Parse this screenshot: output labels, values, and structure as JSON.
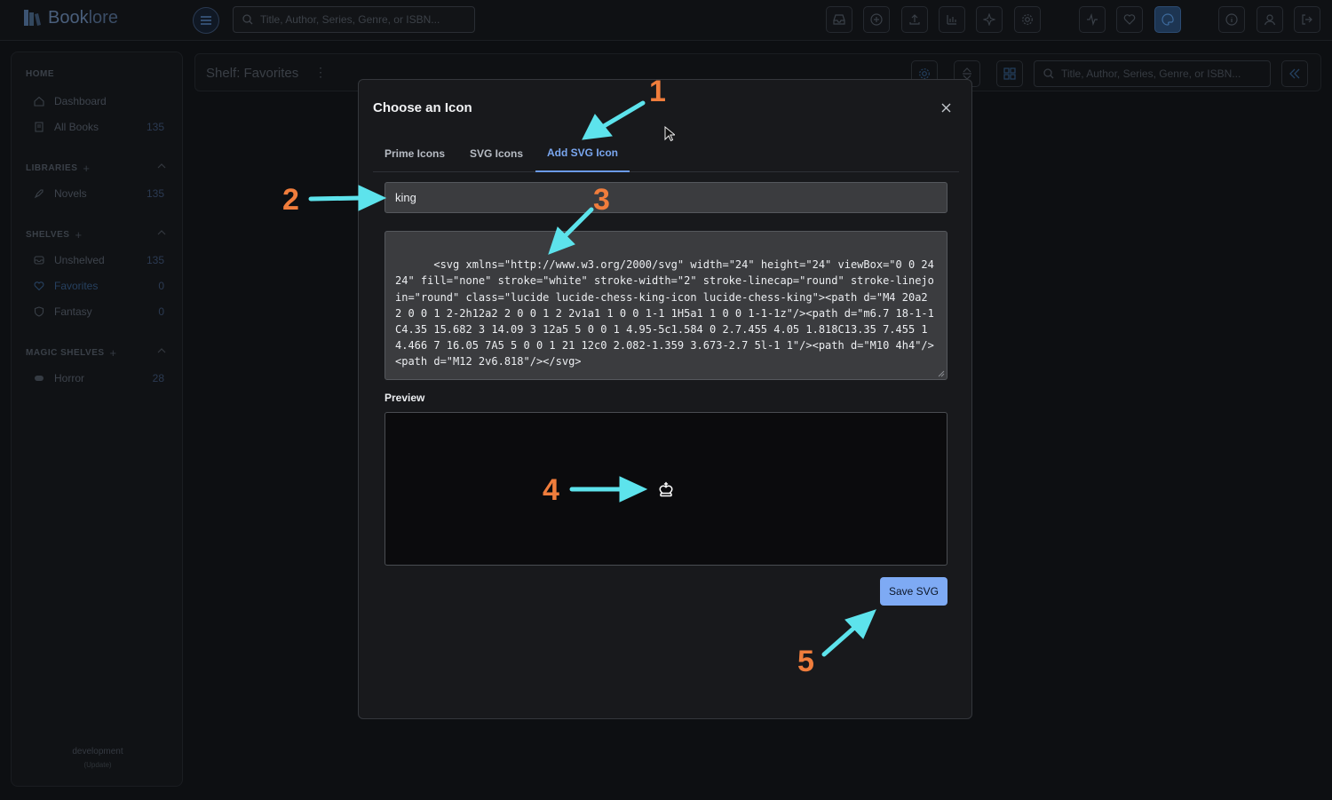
{
  "app": {
    "name_part1": "Book",
    "name_part2": "lore",
    "search_placeholder": "Title, Author, Series, Genre, or ISBN..."
  },
  "sidebar": {
    "home_section": "HOME",
    "home_items": [
      {
        "label": "Dashboard",
        "count": ""
      },
      {
        "label": "All Books",
        "count": "135"
      }
    ],
    "libraries_section": "LIBRARIES",
    "library_items": [
      {
        "label": "Novels",
        "count": "135"
      }
    ],
    "shelves_section": "SHELVES",
    "shelf_items": [
      {
        "label": "Unshelved",
        "count": "135"
      },
      {
        "label": "Favorites",
        "count": "0"
      },
      {
        "label": "Fantasy",
        "count": "0"
      }
    ],
    "magic_section": "MAGIC SHELVES",
    "magic_items": [
      {
        "label": "Horror",
        "count": "28"
      }
    ],
    "footer_env": "development",
    "footer_update": "(Update)"
  },
  "content": {
    "title": "Shelf: Favorites",
    "search_placeholder": "Title, Author, Series, Genre, or ISBN..."
  },
  "modal": {
    "title": "Choose an Icon",
    "tabs": [
      "Prime Icons",
      "SVG Icons",
      "Add SVG Icon"
    ],
    "active_tab": "Add SVG Icon",
    "icon_name_value": "king",
    "svg_code": "<svg xmlns=\"http://www.w3.org/2000/svg\" width=\"24\" height=\"24\" viewBox=\"0 0 24 24\" fill=\"none\" stroke=\"white\" stroke-width=\"2\" stroke-linecap=\"round\" stroke-linejoin=\"round\" class=\"lucide lucide-chess-king-icon lucide-chess-king\"><path d=\"M4 20a2 2 0 0 1 2-2h12a2 2 0 0 1 2 2v1a1 1 0 0 1-1 1H5a1 1 0 0 1-1-1z\"/><path d=\"m6.7 18-1-1C4.35 15.682 3 14.09 3 12a5 5 0 0 1 4.95-5c1.584 0 2.7.455 4.05 1.818C13.35 7.455 14.466 7 16.05 7A5 5 0 0 1 21 12c0 2.082-1.359 3.673-2.7 5l-1 1\"/><path d=\"M10 4h4\"/><path d=\"M12 2v6.818\"/></svg>",
    "preview_label": "Preview",
    "save_label": "Save SVG"
  },
  "annotations": [
    "1",
    "2",
    "3",
    "4",
    "5"
  ],
  "colors": {
    "accent": "#7eaaf4",
    "annotation_number": "#f07d3c",
    "annotation_arrow": "#5de3ec"
  }
}
